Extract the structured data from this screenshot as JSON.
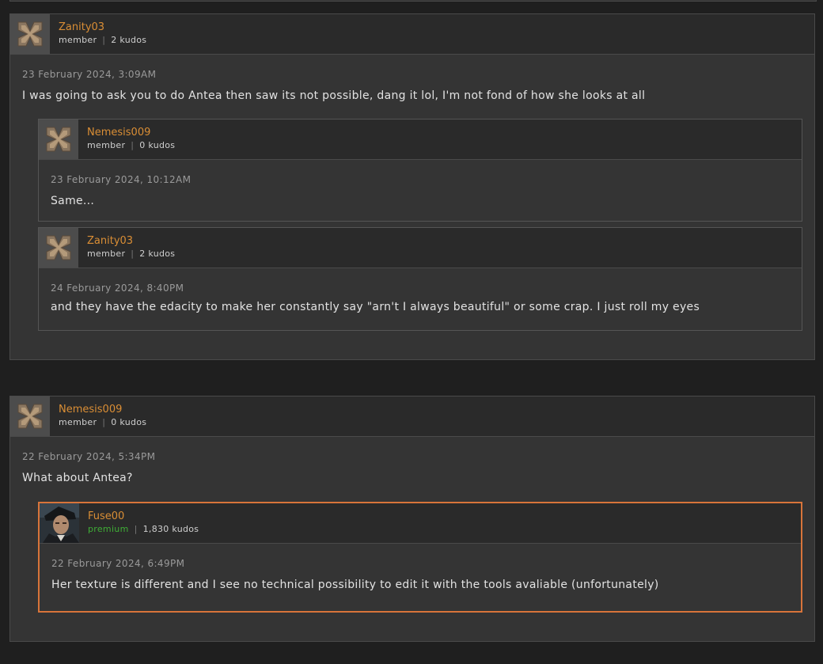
{
  "threads": [
    {
      "author": "Zanity03",
      "role": "member",
      "kudos": "2 kudos",
      "date": "23 February 2024, 3:09AM",
      "text": "I was going to ask you to do Antea then saw its not possible, dang it lol, I'm not fond of how she looks at all",
      "avatar_icon": "default-avatar-icon",
      "replies": [
        {
          "author": "Nemesis009",
          "role": "member",
          "kudos": "0 kudos",
          "date": "23 February 2024, 10:12AM",
          "text": "Same...",
          "avatar_icon": "default-avatar-icon"
        },
        {
          "author": "Zanity03",
          "role": "member",
          "kudos": "2 kudos",
          "date": "24 February 2024, 8:40PM",
          "text": "and they have the edacity to make her constantly say \"arn't I always beautiful\" or some crap. I just roll my eyes",
          "avatar_icon": "default-avatar-icon"
        }
      ]
    },
    {
      "author": "Nemesis009",
      "role": "member",
      "kudos": "0 kudos",
      "date": "22 February 2024, 5:34PM",
      "text": "What about Antea?",
      "avatar_icon": "default-avatar-icon",
      "replies": [
        {
          "author": "Fuse00",
          "role": "premium",
          "kudos": "1,830 kudos",
          "date": "22 February 2024, 6:49PM",
          "text": "Her texture is different and I see no technical possibility to edit it with the tools avaliable (unfortunately)",
          "avatar_icon": "portrait-avatar-icon"
        }
      ]
    }
  ],
  "colors": {
    "author": "#da8e35",
    "premium_role": "#3fae36",
    "premium_border": "#d8743a",
    "panel": "#343434",
    "header": "#2a2a2a"
  }
}
